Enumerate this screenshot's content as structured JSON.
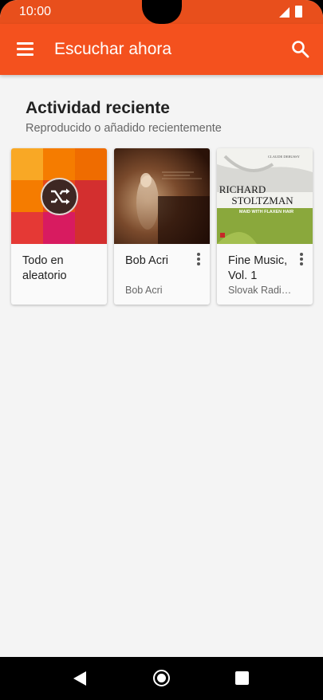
{
  "status_bar": {
    "time": "10:00",
    "icons": [
      "signal-icon",
      "battery-icon"
    ]
  },
  "app_bar": {
    "title": "Escuchar ahora",
    "menu_icon": "menu-icon",
    "search_icon": "search-icon",
    "color": "#f4511e"
  },
  "section": {
    "title": "Actividad reciente",
    "subtitle": "Reproducido o añadido recientemente"
  },
  "cards": [
    {
      "title": "Todo en aleatorio",
      "subtitle": "",
      "art": "shuffle-tile-art",
      "icon": "shuffle-icon"
    },
    {
      "title": "Bob Acri",
      "subtitle": "Bob Acri",
      "art": "album-art-bob-acri",
      "icon": "more-vert-icon"
    },
    {
      "title": "Fine Music, Vol. 1",
      "subtitle": "Slovak Radi…",
      "art": "album-art-fine-music",
      "art_text": {
        "top": "CLAUDE DEBUSSY",
        "name_line1": "RICHARD",
        "name_line2": "STOLTZMAN",
        "band": "MAID WITH FLAXEN HAIR"
      },
      "icon": "more-vert-icon"
    }
  ],
  "nav_bar": {
    "icons": [
      "back-icon",
      "home-icon",
      "recents-icon"
    ]
  }
}
